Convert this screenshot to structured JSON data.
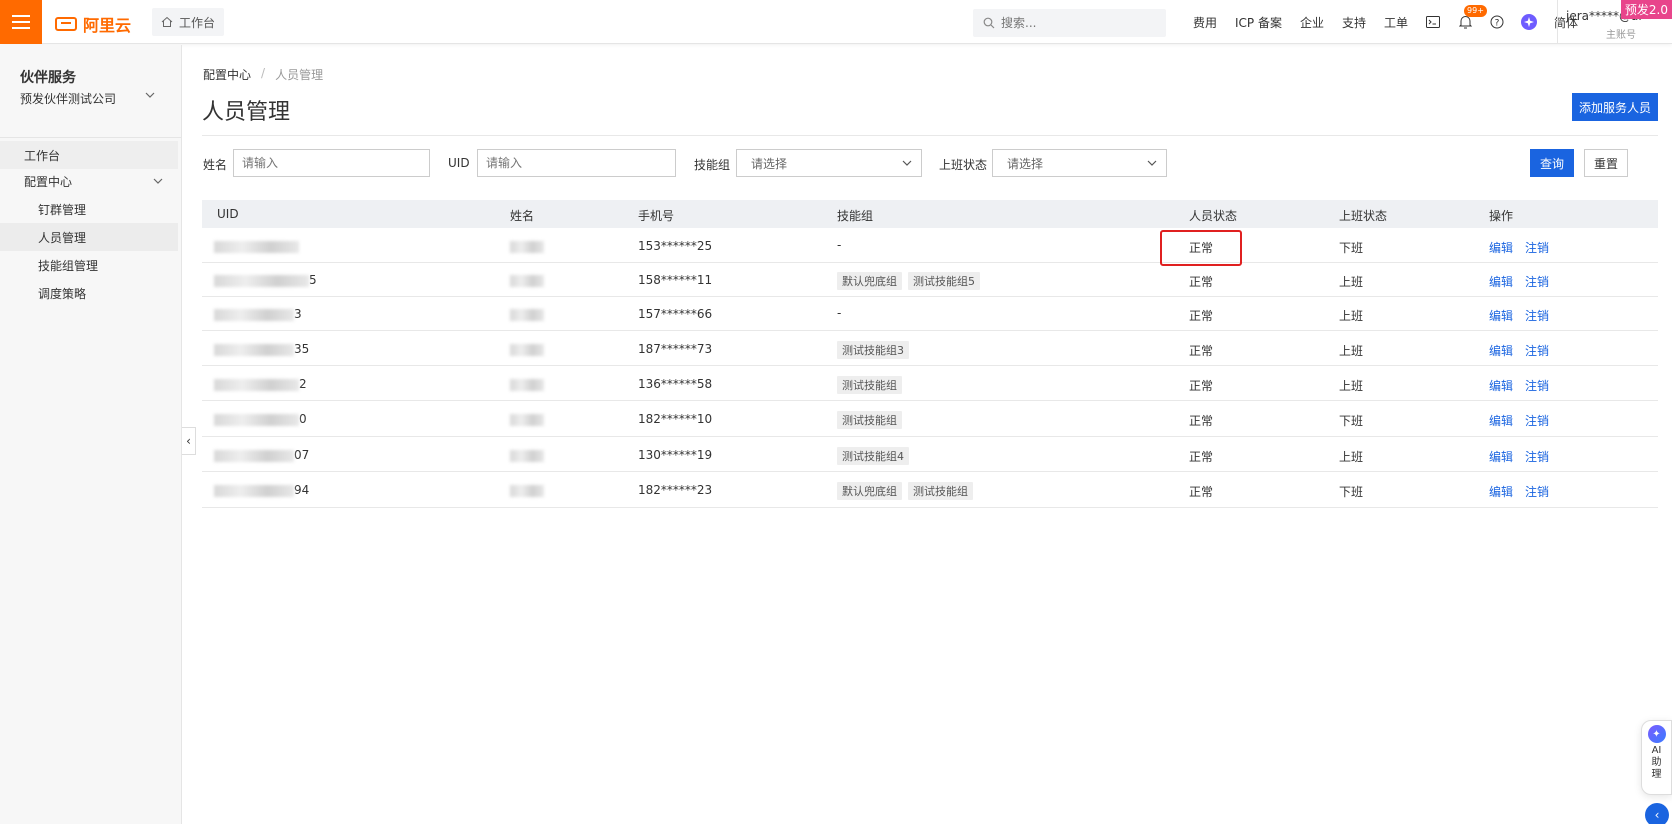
{
  "header": {
    "logo_text": "阿里云",
    "workbench": "工作台",
    "search_placeholder": "搜索...",
    "nav": [
      "费用",
      "ICP 备案",
      "企业",
      "支持",
      "工单"
    ],
    "notification_badge": "99+",
    "language": "简体",
    "user_name": "jera*****@al",
    "user_role": "主账号",
    "env_tag": "预发2.0"
  },
  "sidebar": {
    "title": "伙伴服务",
    "company": "预发伙伴测试公司",
    "items": [
      {
        "label": "工作台"
      },
      {
        "label": "配置中心"
      },
      {
        "label": "钉群管理"
      },
      {
        "label": "人员管理"
      },
      {
        "label": "技能组管理"
      },
      {
        "label": "调度策略"
      }
    ]
  },
  "main": {
    "breadcrumb": [
      "配置中心",
      "/",
      "人员管理"
    ],
    "title": "人员管理",
    "add_button": "添加服务人员",
    "filters": {
      "name_label": "姓名",
      "name_placeholder": "请输入",
      "uid_label": "UID",
      "uid_placeholder": "请输入",
      "skill_label": "技能组",
      "skill_placeholder": "请选择",
      "shift_label": "上班状态",
      "shift_placeholder": "请选择",
      "query": "查询",
      "reset": "重置"
    },
    "table": {
      "columns": [
        "UID",
        "姓名",
        "手机号",
        "技能组",
        "人员状态",
        "上班状态",
        "操作"
      ],
      "rows": [
        {
          "uid_suffix": "",
          "phone": "153******25",
          "skills": [],
          "skills_empty": "-",
          "status": "正常",
          "shift": "下班"
        },
        {
          "uid_suffix": "5",
          "phone": "158******11",
          "skills": [
            "默认兜底组",
            "测试技能组5"
          ],
          "skills_empty": "",
          "status": "正常",
          "shift": "上班"
        },
        {
          "uid_suffix": "3",
          "phone": "157******66",
          "skills": [],
          "skills_empty": "-",
          "status": "正常",
          "shift": "上班"
        },
        {
          "uid_suffix": "35",
          "phone": "187******73",
          "skills": [
            "测试技能组3"
          ],
          "skills_empty": "",
          "status": "正常",
          "shift": "上班"
        },
        {
          "uid_suffix": "2",
          "phone": "136******58",
          "skills": [
            "测试技能组"
          ],
          "skills_empty": "",
          "status": "正常",
          "shift": "上班"
        },
        {
          "uid_suffix": "0",
          "phone": "182******10",
          "skills": [
            "测试技能组"
          ],
          "skills_empty": "",
          "status": "正常",
          "shift": "下班"
        },
        {
          "uid_suffix": "07",
          "phone": "130******19",
          "skills": [
            "测试技能组4"
          ],
          "skills_empty": "",
          "status": "正常",
          "shift": "上班"
        },
        {
          "uid_suffix": "94",
          "phone": "182******23",
          "skills": [
            "默认兜底组",
            "测试技能组"
          ],
          "skills_empty": "",
          "status": "正常",
          "shift": "下班"
        }
      ],
      "actions": [
        "编辑",
        "注销"
      ]
    }
  },
  "ai_assistant": {
    "label": "AI助理"
  },
  "colors": {
    "accent": "#ff6a00",
    "primary": "#1a64e0",
    "highlight_box": "#e02020"
  }
}
